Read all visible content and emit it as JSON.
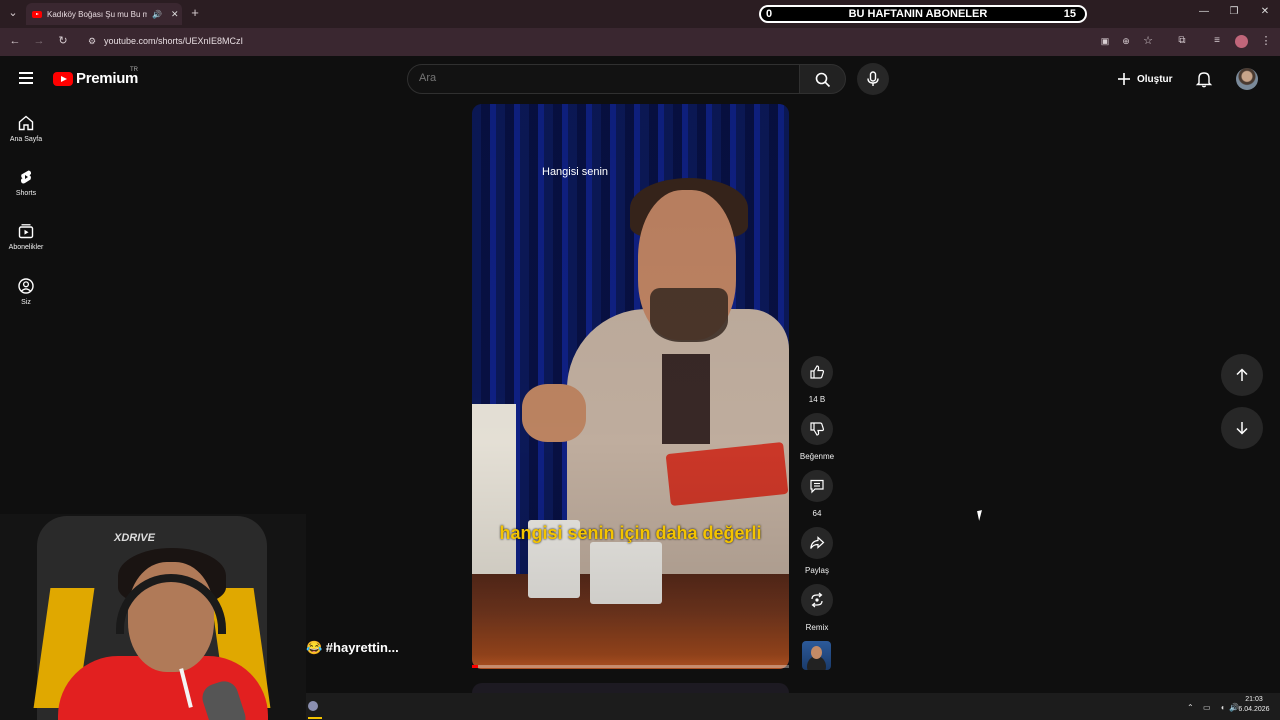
{
  "browser": {
    "tab_title": "Kadıköy Boğası Şu mu Bu m",
    "url": "youtube.com/shorts/UEXnIE8MCzI",
    "overlay": {
      "left": "0",
      "title": "BU HAFTANIN ABONELER",
      "right": "15"
    }
  },
  "header": {
    "logo_text": "Premium",
    "logo_region": "TR",
    "search_placeholder": "Ara",
    "create_label": "Oluştur"
  },
  "sidebar": {
    "items": [
      {
        "label": "Ana Sayfa",
        "icon": "home-icon"
      },
      {
        "label": "Shorts",
        "icon": "shorts-icon"
      },
      {
        "label": "Abonelikler",
        "icon": "subscriptions-icon"
      },
      {
        "label": "Siz",
        "icon": "account-icon"
      }
    ]
  },
  "video": {
    "caption_top": "Hangisi senin",
    "subtitle": "hangisi senin için daha değerli",
    "progress": 0.02
  },
  "actions": {
    "like_count": "14 B",
    "dislike_label": "Beğenme",
    "comment_count": "64",
    "share_label": "Paylaş",
    "remix_label": "Remix"
  },
  "overlay_tag": "😂 #hayrettin...",
  "webcam": {
    "chair_brand": "XDRIVE"
  },
  "taskbar": {
    "time": "21:03",
    "date": "6.04.2026"
  },
  "colors": {
    "accent": "#ff0000",
    "subtitle": "#f4c400",
    "background": "#0f0f0f"
  }
}
